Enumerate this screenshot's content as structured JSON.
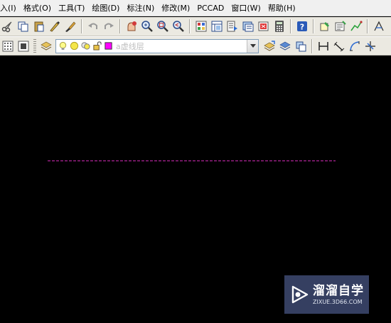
{
  "menubar": {
    "items": [
      "入(I)",
      "格式(O)",
      "工具(T)",
      "绘图(D)",
      "标注(N)",
      "修改(M)",
      "PCCAD",
      "窗口(W)",
      "帮助(H)"
    ]
  },
  "toolbar_standard": {
    "icons": [
      "cut-icon",
      "copy-icon",
      "paste-icon",
      "match-properties-icon",
      "brush-icon",
      "undo-icon",
      "redo-icon",
      "pan-icon",
      "zoom-realtime-icon",
      "zoom-window-icon",
      "zoom-previous-icon",
      "properties-icon",
      "design-center-icon",
      "tool-palettes-icon",
      "sheet-set-icon",
      "markup-icon",
      "calculator-icon",
      "help-icon",
      "block-editor-icon",
      "attribute-icon",
      "polyline-icon",
      "dimension-icon"
    ]
  },
  "layer_bar": {
    "current_layer": "a虚线层",
    "icons": [
      "layer-properties-icon",
      "make-current-icon",
      "layer-previous-icon",
      "layer-states-icon"
    ]
  },
  "dimension_bar": {
    "icons": [
      "linear-dim-icon",
      "aligned-dim-icon",
      "arc-dim-icon",
      "ordinate-dim-icon"
    ]
  },
  "watermark": {
    "title": "溜溜自学",
    "url": "ZIXUE.3D66.COM"
  },
  "colors": {
    "canvas": "#000000",
    "dashed_line": "#b0259a",
    "layer_swatch": "#ff00ff",
    "watermark_bg": "#3c486e"
  }
}
